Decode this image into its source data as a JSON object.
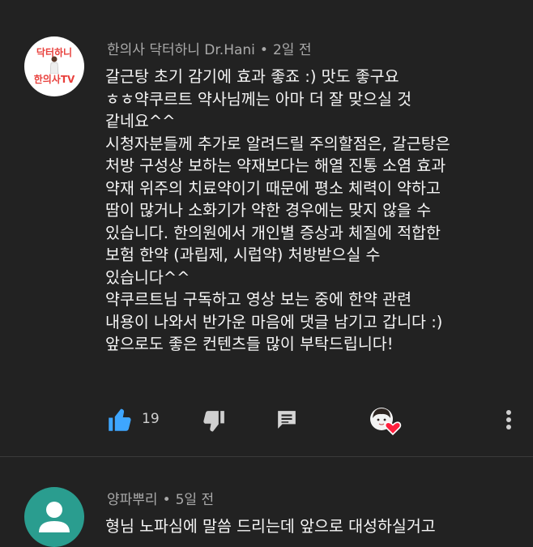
{
  "comments": [
    {
      "author": "한의사 닥터하니 Dr.Hani",
      "time": "2일 전",
      "avatar_text_top": "닥터하니",
      "avatar_text_bottom": "한의사TV",
      "body": "갈근탕 초기 감기에 효과 좋죠 :) 맛도 좋구요\nㅎㅎ약쿠르트 약사님께는 아마 더 잘 맞으실 것\n같네요^^\n시청자분들께 추가로 알려드릴 주의할점은, 갈근탕은\n처방 구성상 보하는 약재보다는 해열 진통 소염 효과\n약재 위주의 치료약이기 때문에  평소 체력이 약하고\n땀이 많거나 소화기가 약한 경우에는 맞지 않을 수\n있습니다. 한의원에서 개인별 증상과 체질에 적합한\n보험 한약 (과립제, 시럽약) 처방받으실 수\n있습니다^^\n약쿠르트님 구독하고 영상 보는 중에 한약 관련\n내용이 나와서 반가운 마음에 댓글 남기고 갑니다 :)\n앞으로도 좋은 컨텐츠들 많이 부탁드립니다!",
      "likes": "19",
      "icons": [
        "thumb-up-icon",
        "thumb-down-icon",
        "reply-icon",
        "creator-heart-icon",
        "more-icon"
      ]
    },
    {
      "author": "양파뿌리",
      "time": "5일 전",
      "body": "형님 노파심에 말씀 드리는데 앞으로 대성하실거고"
    }
  ],
  "colors": {
    "background": "#222222",
    "meta_text": "#aaaaaa",
    "like_active": "#3ea6ff",
    "brand": "#e8403c",
    "heart": "#ff1f3d"
  }
}
